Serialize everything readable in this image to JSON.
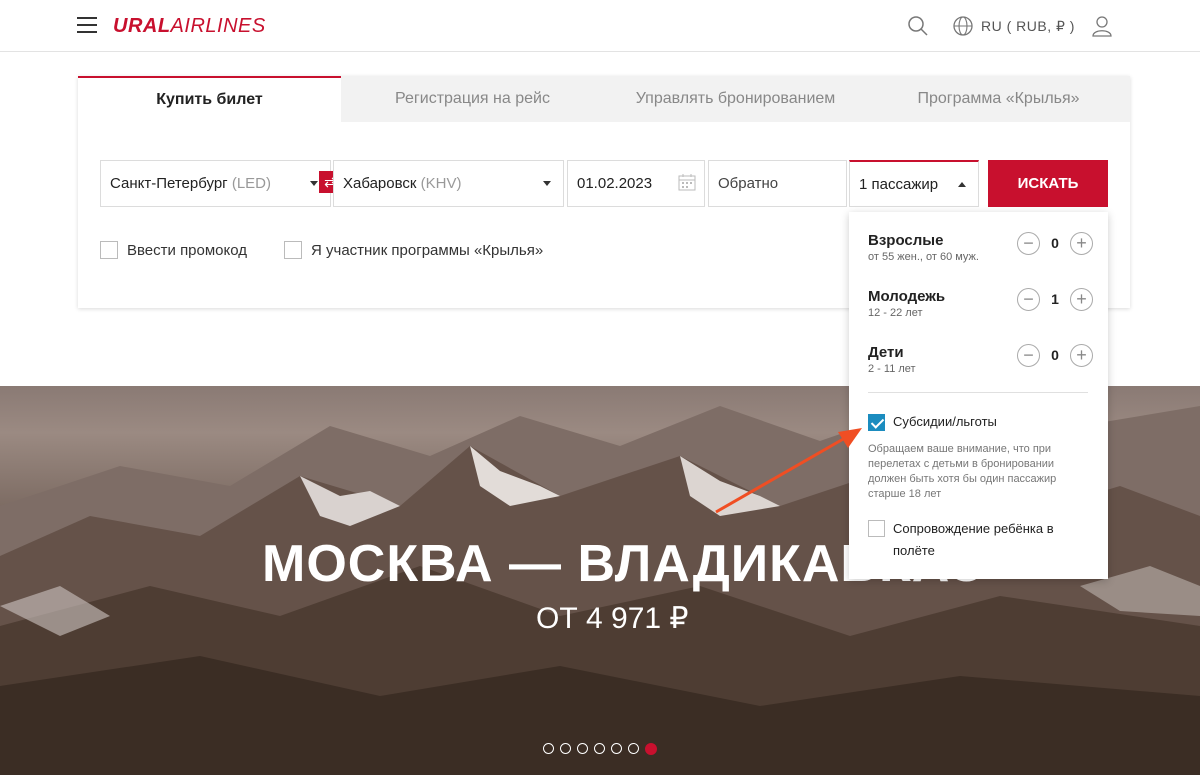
{
  "header": {
    "logo_ural": "URAL",
    "logo_airlines": "AIRLINES",
    "lang": "RU ( RUB, ₽ )",
    "icons": [
      "menu-icon",
      "search-icon",
      "globe-icon",
      "user-icon"
    ]
  },
  "tabs": [
    {
      "label": "Купить билет",
      "active": true
    },
    {
      "label": "Регистрация на рейс",
      "active": false
    },
    {
      "label": "Управлять бронированием",
      "active": false
    },
    {
      "label": "Программа «Крылья»",
      "active": false
    }
  ],
  "form": {
    "from_city": "Санкт-Петербург",
    "from_code": "(LED)",
    "to_city": "Хабаровск",
    "to_code": "(KHV)",
    "depart_date": "01.02.2023",
    "return_placeholder": "Обратно",
    "passengers": "1 пассажир",
    "search_label": "ИСКАТЬ",
    "promo_label": "Ввести промокод",
    "wings_label": "Я участник программы «Крылья»"
  },
  "passengers": [
    {
      "name": "Взрослые",
      "sub": "от 55 жен., от 60 муж.",
      "count": "0"
    },
    {
      "name": "Молодежь",
      "sub": "12 - 22 лет",
      "count": "1"
    },
    {
      "name": "Дети",
      "sub": "2 - 11 лет",
      "count": "0"
    }
  ],
  "options": {
    "subsidy_label": "Субсидии/льготы",
    "subsidy_checked": true,
    "notice": "Обращаем ваше внимание, что при перелетах с детьми в бронировании должен быть хотя бы один пассажир старше 18 лет",
    "escort_label": "Сопровождение ребёнка в полёте",
    "escort_checked": false
  },
  "hero": {
    "title": "МОСКВА — ВЛАДИКАВКАЗ",
    "price": "ОТ 4 971 ₽",
    "slides": 7,
    "active_slide": 7
  },
  "colors": {
    "brand": "#c8102e",
    "checkbox": "#1b8cbf",
    "annotation_arrow": "#f04e23"
  }
}
